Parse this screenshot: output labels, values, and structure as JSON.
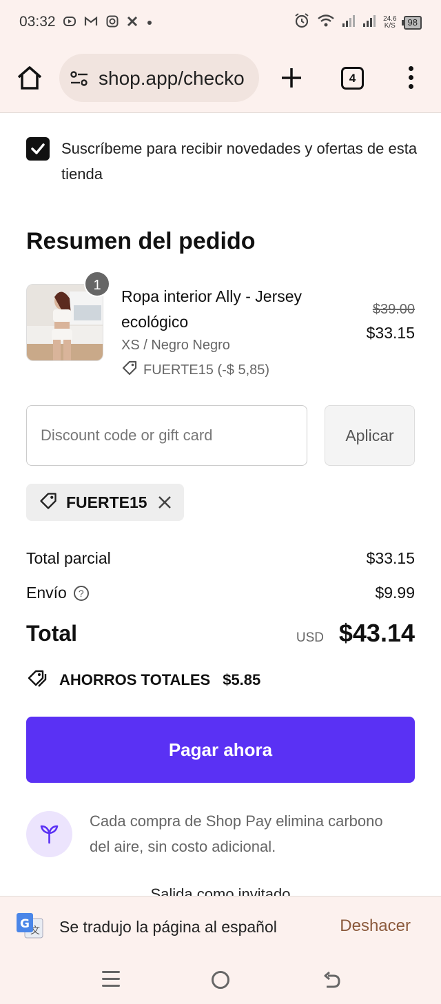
{
  "status_bar": {
    "time": "03:32",
    "left_icons": [
      "youtube-icon",
      "gmail-icon",
      "instagram-icon",
      "app-icon",
      "dot-icon"
    ],
    "right_icons": [
      "alarm-icon",
      "wifi-icon",
      "signal-icon",
      "signal-icon"
    ],
    "net_speed_value": "24.6",
    "net_speed_unit": "K/S",
    "battery": "98"
  },
  "browser": {
    "url": "shop.app/checko",
    "tab_count": "4"
  },
  "subscribe": {
    "checked": true,
    "label": "Suscríbeme para recibir novedades y ofertas de esta tienda"
  },
  "order_summary": {
    "title": "Resumen del pedido",
    "item": {
      "quantity": "1",
      "name": "Ropa interior Ally - Jersey ecológico",
      "variant": "XS / Negro Negro",
      "discount": "FUERTE15 (-$ 5,85)",
      "original_price": "$39.00",
      "price": "$33.15"
    }
  },
  "discount": {
    "placeholder": "Discount code or gift card",
    "apply_label": "Aplicar",
    "applied_code": "FUERTE15"
  },
  "totals": {
    "subtotal_label": "Total parcial",
    "subtotal_value": "$33.15",
    "shipping_label": "Envío",
    "shipping_value": "$9.99",
    "total_label": "Total",
    "currency": "USD",
    "total_value": "$43.14",
    "savings_label": "AHORROS TOTALES",
    "savings_value": "$5.85"
  },
  "pay_button": "Pagar ahora",
  "carbon_note": "Cada compra de Shop Pay elimina carbono del aire, sin costo adicional.",
  "guest_checkout": "Salida como invitado",
  "translate": {
    "message": "Se tradujo la página al español",
    "undo": "Deshacer"
  },
  "colors": {
    "accent": "#5a31f4",
    "chrome": "#fcf1ee",
    "undo_link": "#8b5a3c"
  }
}
